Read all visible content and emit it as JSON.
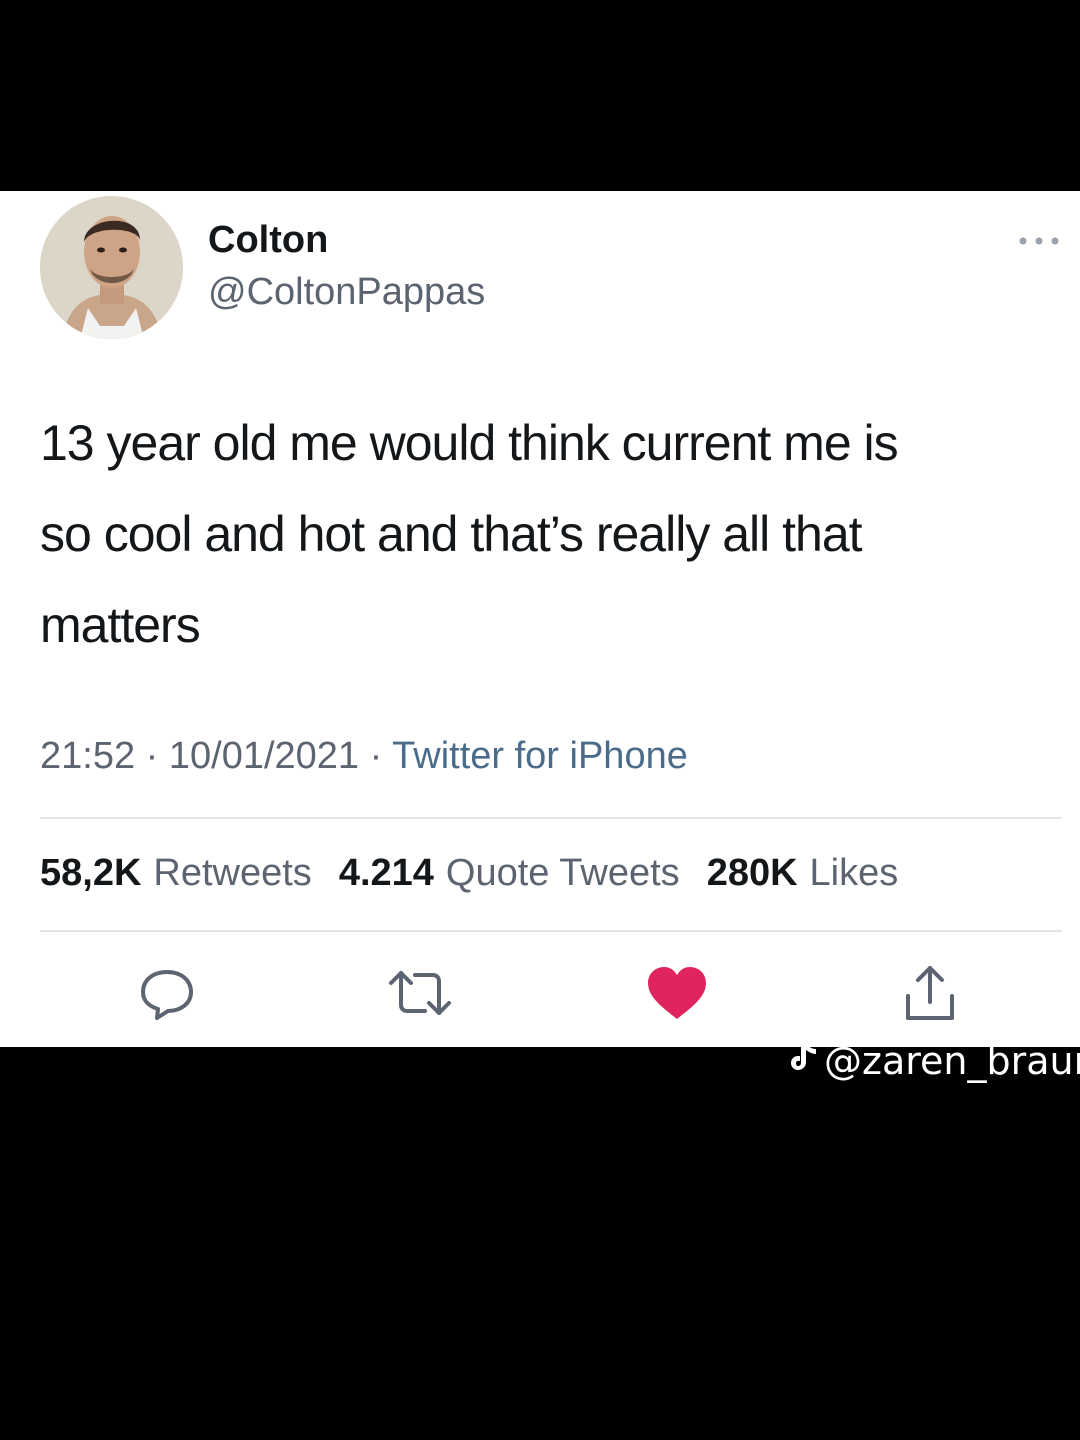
{
  "tweet": {
    "author": {
      "display_name": "Colton",
      "handle": "@ColtonPappas"
    },
    "text_lines": [
      "13 year old me would think current me is",
      "so cool and hot and that’s really all that",
      "matters"
    ],
    "time": "21:52",
    "date": "10/01/2021",
    "separator": "·",
    "source": "Twitter for iPhone",
    "stats": {
      "retweets": {
        "value": "58,2K",
        "label": "Retweets"
      },
      "quotes": {
        "value": "4.214",
        "label": "Quote Tweets"
      },
      "likes": {
        "value": "280K",
        "label": "Likes"
      }
    },
    "actions": [
      "reply-icon",
      "retweet-icon",
      "like-icon",
      "share-icon"
    ]
  },
  "overlay": {
    "watermark_handle": "@zaren_braun",
    "watermark_icon": "tiktok-icon"
  },
  "colors": {
    "background": "#000000",
    "card": "#ffffff",
    "text": "#14171a",
    "secondary": "#5b6470",
    "like": "#e0245e"
  }
}
